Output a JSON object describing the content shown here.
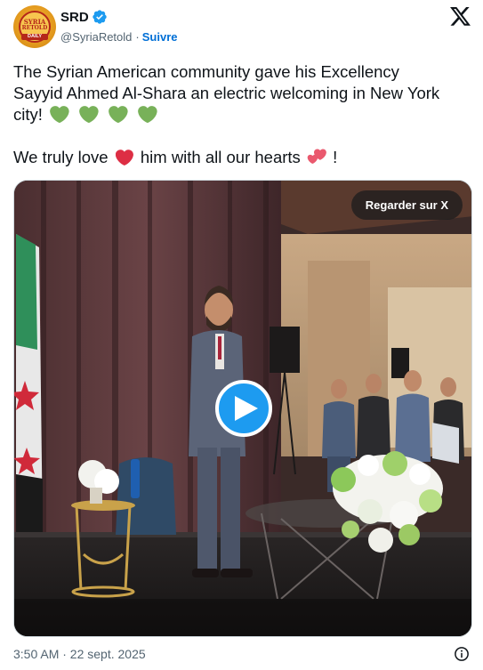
{
  "author": {
    "display_name": "SRD",
    "handle": "@SyriaRetold",
    "separator": "·",
    "follow_label": "Suivre",
    "avatar": {
      "line1": "SYRIA",
      "line2": "RETOLD",
      "line3": "DAILY"
    }
  },
  "tweet": {
    "line1": "The Syrian American community gave his Excellency",
    "line2": "Sayyid Ahmed Al-Shara an electric welcoming in New York",
    "line3": "city!",
    "line4_a": "We truly love",
    "line4_b": "him with all our hearts",
    "line4_end": "!"
  },
  "media": {
    "watch_label": "Regarder sur X"
  },
  "footer": {
    "timestamp": "3:50 AM · 22 sept. 2025"
  },
  "colors": {
    "accent": "#1d9bf0",
    "follow": "#006fd6",
    "green_heart": "#78b159",
    "red_heart": "#dd2e44",
    "muted_text": "#536471"
  },
  "icons": [
    "verified-badge-icon",
    "x-logo-icon",
    "green-heart-icon",
    "red-heart-icon",
    "two-hearts-icon",
    "play-icon",
    "info-icon"
  ]
}
